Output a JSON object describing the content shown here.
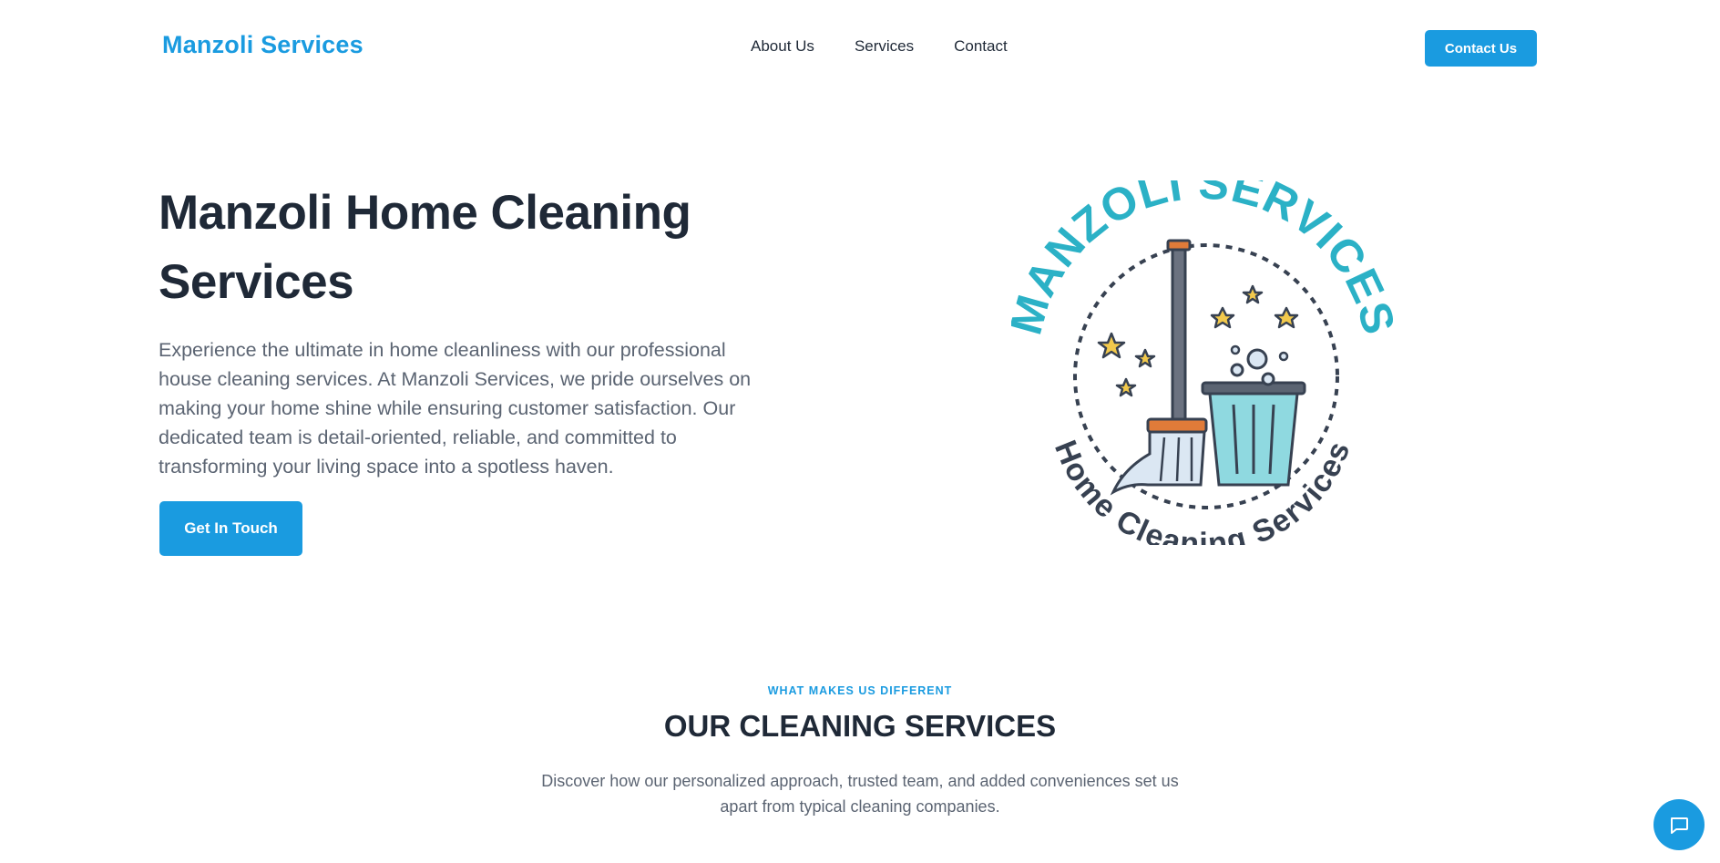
{
  "header": {
    "brand": "Manzoli Services",
    "nav": [
      "About Us",
      "Services",
      "Contact"
    ],
    "cta_label": "Contact Us"
  },
  "hero": {
    "title": "Manzoli Home Cleaning Services",
    "description": "Experience the ultimate in home cleanliness with our professional house cleaning services. At Manzoli Services, we pride ourselves on making your home shine while ensuring customer satisfaction. Our dedicated team is detail-oriented, reliable, and committed to transforming your living space into a spotless haven.",
    "cta_label": "Get In Touch",
    "logo": {
      "top_text": "MANZOLI SERVICES",
      "bottom_text": "Home Cleaning Services"
    }
  },
  "services": {
    "eyebrow": "WHAT MAKES US DIFFERENT",
    "title": "OUR CLEANING SERVICES",
    "description": "Discover how our personalized approach, trusted team, and added conveniences set us apart from typical cleaning companies."
  },
  "chat": {
    "icon": "chat-bubble-icon"
  },
  "colors": {
    "accent": "#1a9be0",
    "logo_teal": "#2bb1c6",
    "logo_dark": "#374151",
    "heading": "#1f2937",
    "body_text": "#5b6472"
  }
}
